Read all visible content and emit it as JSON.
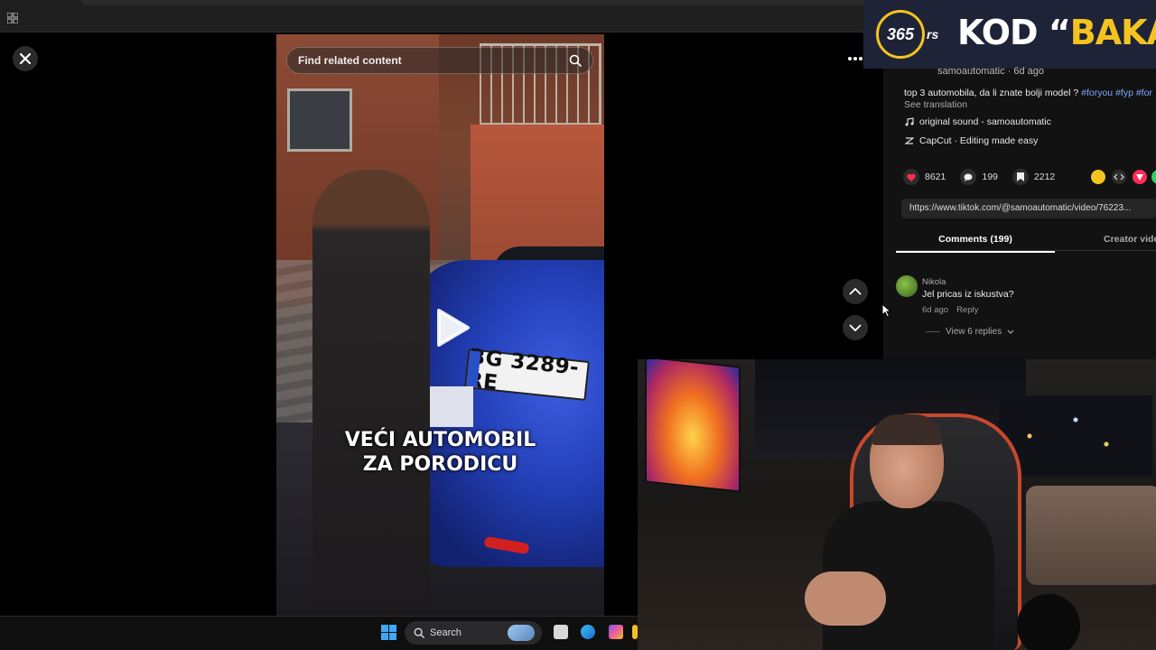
{
  "overlay": {
    "brand_logo": "365",
    "brand_suffix": "rs",
    "title_prefix": "KOD “",
    "title_highlight": "BAKA",
    "title_suffix": "”",
    "accent_color": "#f5c320"
  },
  "video": {
    "search_placeholder": "Find related content",
    "caption_line1": "VEĆI AUTOMOBIL",
    "caption_line2": "ZA PORODICU",
    "plate_text": "BG 3289-RE"
  },
  "post": {
    "author": "samoautomatic · 6d ago",
    "description": "top 3 automobila, da li znate bolji model ? ",
    "hashtags": "#foryou #fyp #for",
    "see_translation": "See translation",
    "sound": "original sound - samoautomatic",
    "capcut": "CapCut · Editing made easy",
    "likes": "8621",
    "comments_count": "199",
    "saves": "2212",
    "link": "https://www.tiktok.com/@samoautomatic/video/76223..."
  },
  "tabs": {
    "comments": "Comments (199)",
    "creator": "Creator vide"
  },
  "comment": {
    "name": "Nikola",
    "text": "Jel pricas iz iskustva?",
    "time": "6d ago",
    "reply": "Reply",
    "view_replies": "View 6 replies"
  },
  "taskbar": {
    "search_label": "Search"
  }
}
